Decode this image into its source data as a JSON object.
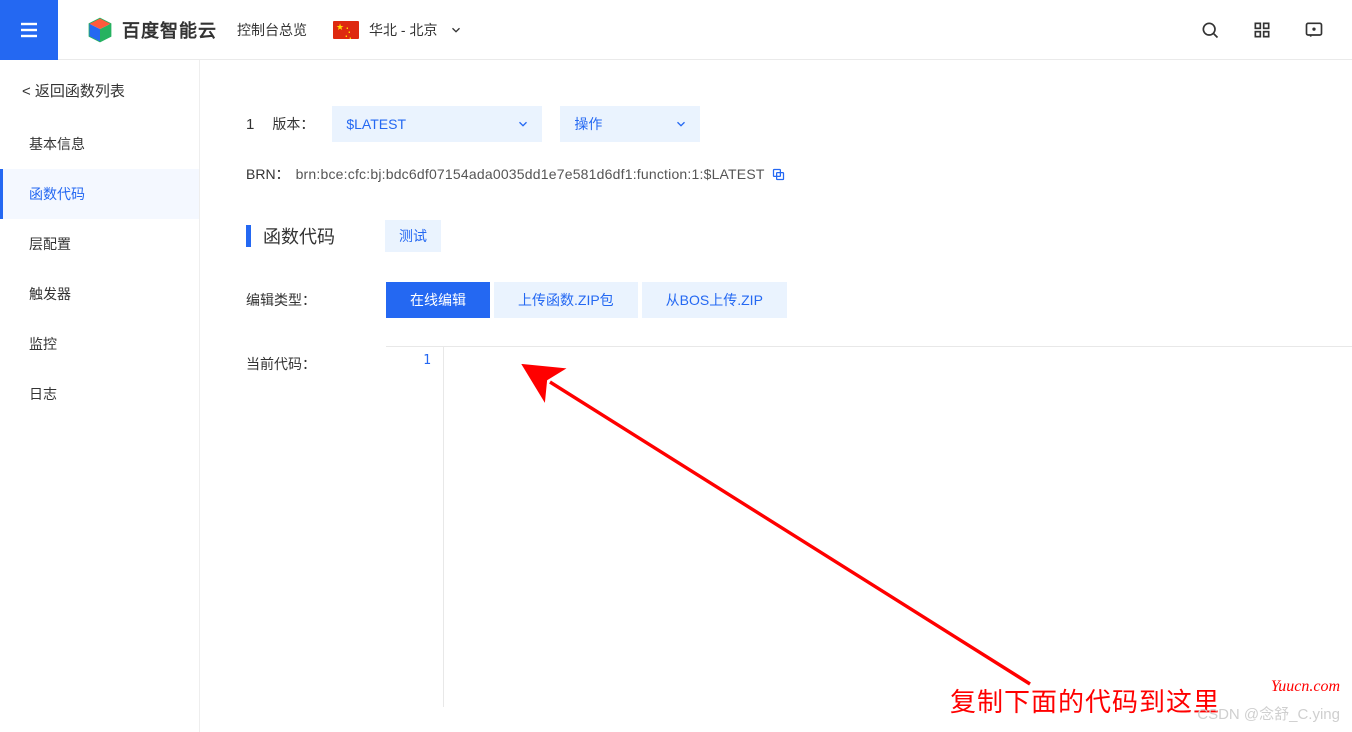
{
  "header": {
    "brand": "百度智能云",
    "consoleLabel": "控制台总览",
    "region": "华北 - 北京"
  },
  "sidebar": {
    "back": "< 返回函数列表",
    "items": [
      {
        "label": "基本信息"
      },
      {
        "label": "函数代码"
      },
      {
        "label": "层配置"
      },
      {
        "label": "触发器"
      },
      {
        "label": "监控"
      },
      {
        "label": "日志"
      }
    ]
  },
  "version": {
    "num": "1",
    "label": "版本：",
    "selectedVersion": "$LATEST",
    "actionsLabel": "操作"
  },
  "brn": {
    "label": "BRN：",
    "value": "brn:bce:cfc:bj:bdc6df07154ada0035dd1e7e581d6df1:function:1:$LATEST"
  },
  "section": {
    "title": "函数代码",
    "testBtn": "测试"
  },
  "editType": {
    "label": "编辑类型：",
    "options": [
      "在线编辑",
      "上传函数.ZIP包",
      "从BOS上传.ZIP"
    ]
  },
  "code": {
    "label": "当前代码：",
    "lineNumber": "1"
  },
  "annotation": "复制下面的代码到这里",
  "watermark1": "Yuucn.com",
  "watermark2": "CSDN @念舒_C.ying"
}
